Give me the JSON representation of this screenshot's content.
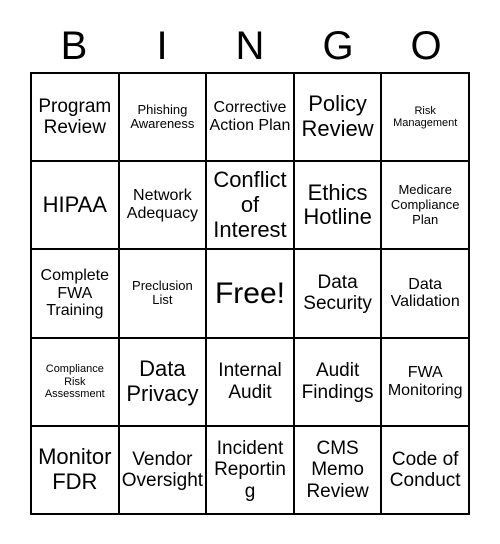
{
  "card": {
    "type": "bingo-card",
    "columns": 5,
    "rows": 5,
    "header_letters": [
      "B",
      "I",
      "N",
      "G",
      "O"
    ],
    "free_space": {
      "label": "Free!",
      "row": 3,
      "column": 3
    },
    "colors": {
      "background": "#ffffff",
      "text": "#000000",
      "grid_line": "#000000"
    },
    "cells": [
      {
        "text": "Program Review",
        "size": "lg"
      },
      {
        "text": "Phishing Awareness",
        "size": "sm"
      },
      {
        "text": "Corrective Action Plan",
        "size": "md"
      },
      {
        "text": "Policy Review",
        "size": "xl"
      },
      {
        "text": "Risk Management",
        "size": "xs"
      },
      {
        "text": "HIPAA",
        "size": "xl"
      },
      {
        "text": "Network Adequacy",
        "size": "md"
      },
      {
        "text": "Conflict of Interest",
        "size": "xl"
      },
      {
        "text": "Ethics Hotline",
        "size": "xl"
      },
      {
        "text": "Medicare Compliance Plan",
        "size": "sm"
      },
      {
        "text": "Complete FWA Training",
        "size": "md"
      },
      {
        "text": "Preclusion List",
        "size": "sm"
      },
      {
        "text": "Free!",
        "size": "free"
      },
      {
        "text": "Data Security",
        "size": "lg"
      },
      {
        "text": "Data Validation",
        "size": "md"
      },
      {
        "text": "Compliance Risk Assessment",
        "size": "xs"
      },
      {
        "text": "Data Privacy",
        "size": "xl"
      },
      {
        "text": "Internal Audit",
        "size": "lg"
      },
      {
        "text": "Audit Findings",
        "size": "lg"
      },
      {
        "text": "FWA Monitoring",
        "size": "md"
      },
      {
        "text": "Monitor FDR",
        "size": "xl"
      },
      {
        "text": "Vendor Oversight",
        "size": "lg"
      },
      {
        "text": "Incident Reporting",
        "size": "lg"
      },
      {
        "text": "CMS Memo Review",
        "size": "lg"
      },
      {
        "text": "Code of Conduct",
        "size": "lg"
      }
    ]
  }
}
